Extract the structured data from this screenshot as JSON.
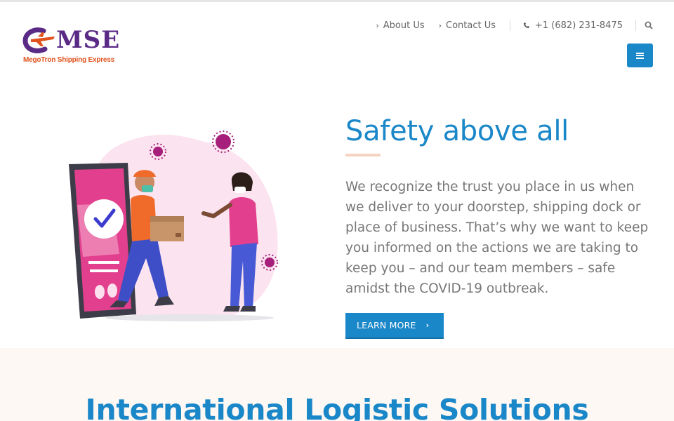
{
  "brand": {
    "logo_text": "MSE",
    "tagline": "MegoTron Shipping Express",
    "colors": {
      "primary": "#1a87c8",
      "logo_purple": "#5a2b86",
      "logo_orange": "#e0531f",
      "accent_rule": "#f5d3c0"
    }
  },
  "topnav": {
    "links": [
      {
        "label": "About Us",
        "icon": "chevron-right-icon"
      },
      {
        "label": "Contact Us",
        "icon": "chevron-right-icon"
      }
    ],
    "phone": {
      "label": "+1 (682) 231-8475",
      "icon": "phone-icon"
    },
    "search_icon": "search-icon",
    "menu_icon": "menu-icon"
  },
  "hero": {
    "title": "Safety above all",
    "body": "We recognize the trust you place in us when we deliver to your doorstep, shipping dock or place of business. That’s why we want to keep you informed on the actions we are taking to keep you – and our team members – safe amidst the COVID-19 outbreak.",
    "button_label": "LEARN MORE",
    "button_icon": "chevron-right-icon",
    "illustration": "delivery-illustration"
  },
  "section": {
    "title": "International Logistic Solutions"
  }
}
